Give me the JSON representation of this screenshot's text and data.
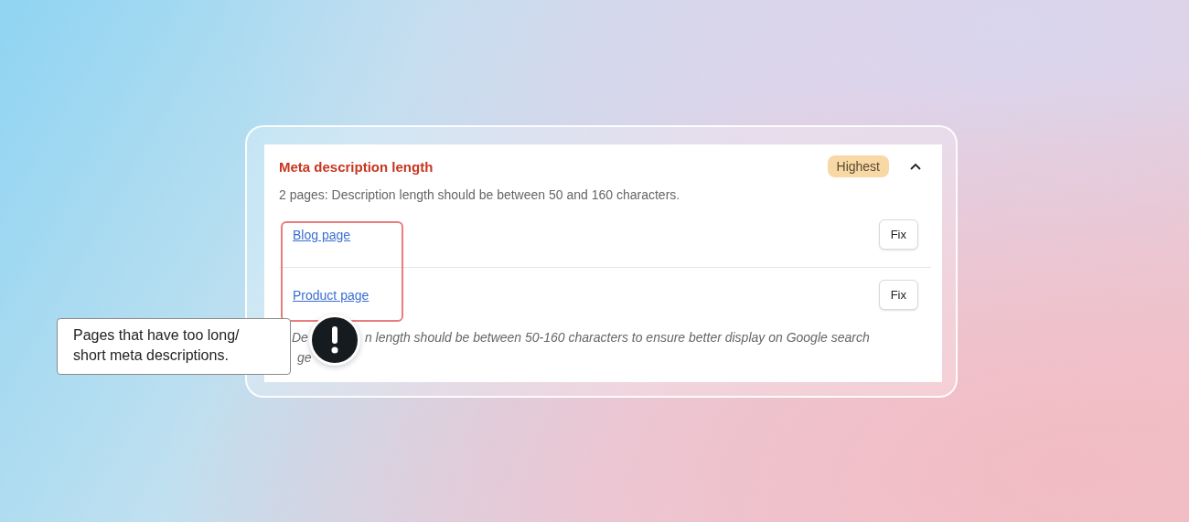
{
  "card": {
    "title": "Meta description length",
    "priority": "Highest",
    "expanded": true,
    "summary": "2 pages: Description length should be between 50 and 160 characters.",
    "pages": [
      {
        "label": "Blog page",
        "action": "Fix"
      },
      {
        "label": "Product page",
        "action": "Fix"
      }
    ],
    "note": {
      "line_1_start": "De",
      "line_1_end": "n length should be between 50-160 characters to ensure better display on Google search",
      "line_2": "ge"
    }
  },
  "callout": {
    "text": "Pages that have too long/ short meta descriptions."
  }
}
